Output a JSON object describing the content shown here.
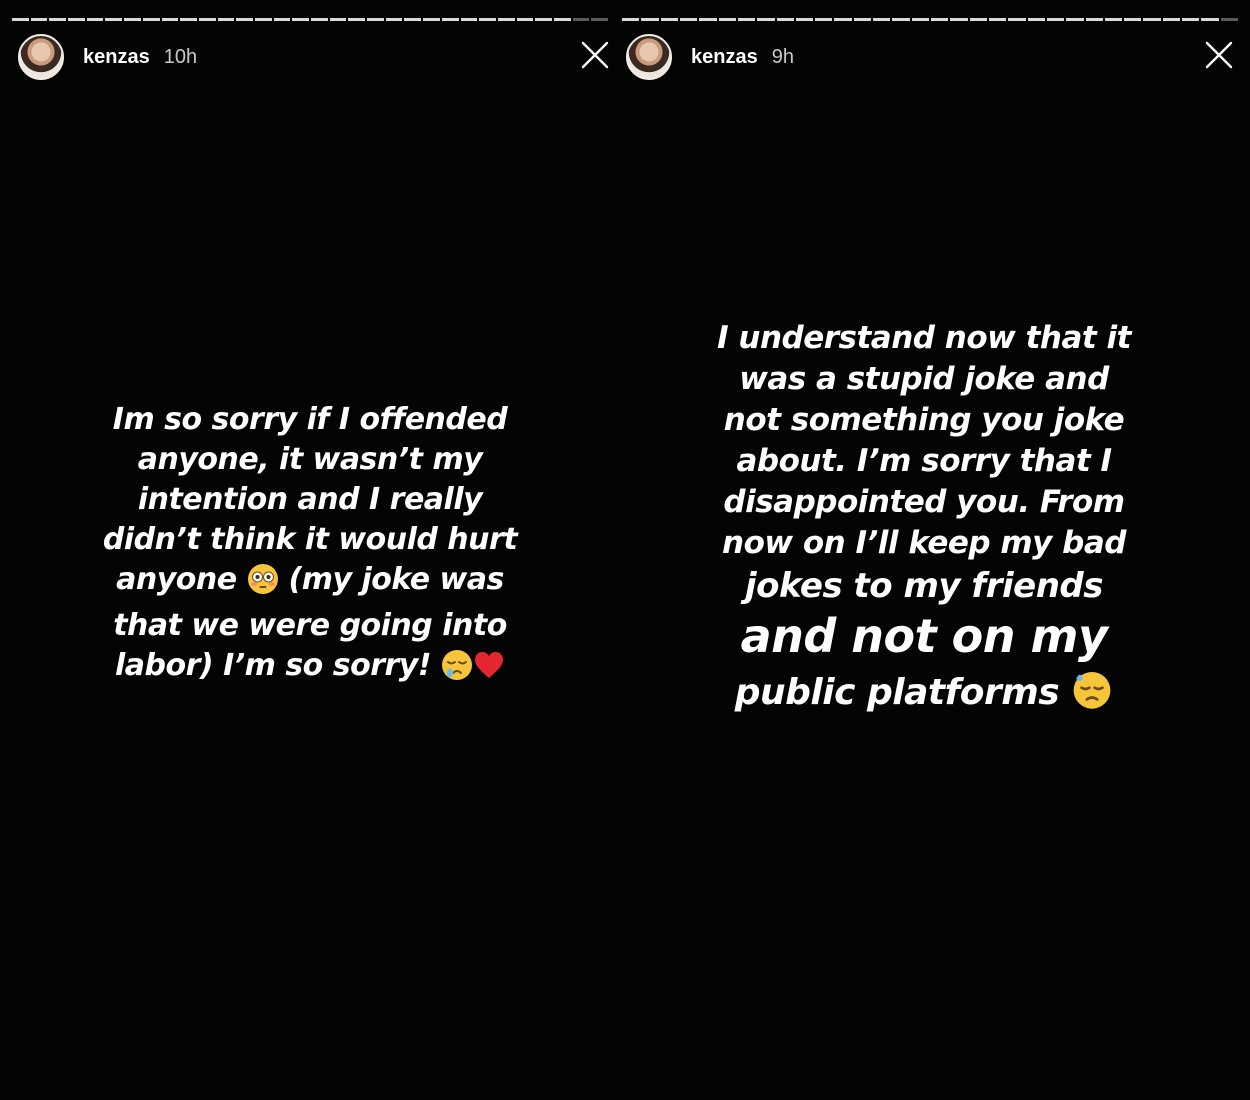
{
  "stories": [
    {
      "username": "kenzas",
      "time": "10h",
      "message_lines": [
        "Im so sorry if I offended",
        "anyone, it wasn’t my",
        "intention and I really",
        "didn’t think it would hurt",
        "anyone",
        "(my joke was",
        "that we were going into",
        "labor) I’m so sorry!"
      ]
    },
    {
      "username": "kenzas",
      "time": "9h",
      "message_lines": [
        "I understand now that it",
        "was a stupid joke and",
        "not something you joke",
        "about. I’m sorry that I",
        "disappointed you. From",
        "now on I’ll keep my bad",
        "jokes to my friends",
        "and not on my",
        "public platforms"
      ]
    }
  ],
  "icons": {
    "close": "close-icon",
    "emoji_flushed": "flushed-face-emoji",
    "emoji_sleepy": "sleepy-face-emoji",
    "emoji_heart": "red-heart-emoji",
    "emoji_sweat": "downcast-face-with-sweat-emoji"
  },
  "colors": {
    "background": "#040404",
    "text": "#ffffff",
    "emoji_yellow": "#f7c53a",
    "heart": "#e3262f"
  }
}
